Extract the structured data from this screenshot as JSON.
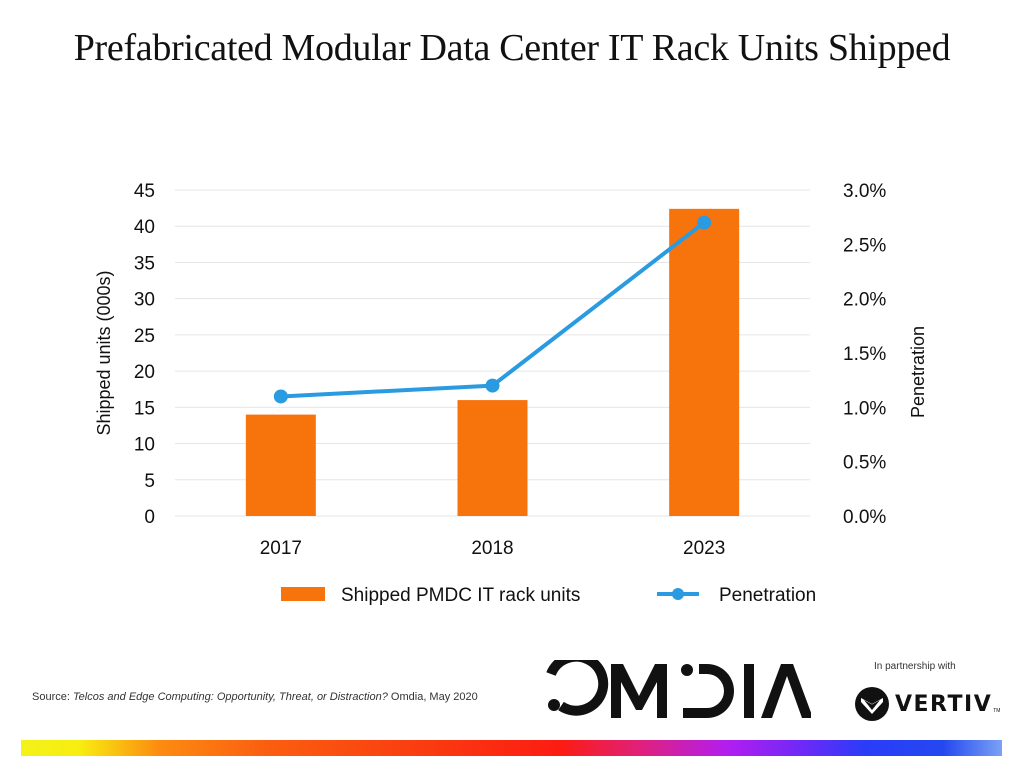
{
  "title": "Prefabricated Modular Data Center IT Rack Units Shipped",
  "chart_data": {
    "type": "bar",
    "title": "Prefabricated Modular Data Center IT Rack Units Shipped",
    "categories": [
      "2017",
      "2018",
      "2023"
    ],
    "series": [
      {
        "name": "Shipped PMDC IT rack units",
        "type": "bar",
        "axis": "left",
        "color": "#f7730c",
        "values": [
          14.0,
          16.0,
          42.4
        ]
      },
      {
        "name": "Penetration",
        "type": "line",
        "axis": "right",
        "color": "#2a9be0",
        "values": [
          1.1,
          1.2,
          2.7
        ]
      }
    ],
    "xlabel": "",
    "ylabel": "Shipped units (000s)",
    "ylabel_right": "Penetration",
    "ylim": [
      0,
      45
    ],
    "ylim_right": [
      0,
      3.0
    ],
    "yticks": [
      "0",
      "5",
      "10",
      "15",
      "20",
      "25",
      "30",
      "35",
      "40",
      "45"
    ],
    "yticks_right": [
      "0.0%",
      "0.5%",
      "1.0%",
      "1.5%",
      "2.0%",
      "2.5%",
      "3.0%"
    ],
    "grid": true,
    "legend_position": "bottom-center"
  },
  "source": {
    "prefix": "Source: ",
    "italic": "Telcos and Edge Computing: Opportunity, Threat, or Distraction?",
    "suffix": " Omdia, May 2020"
  },
  "branding": {
    "omdia_logo": "OMDIA",
    "partner_label": "In partnership with",
    "vertiv_logo": "VERTIV",
    "vertiv_tm": "TM"
  }
}
